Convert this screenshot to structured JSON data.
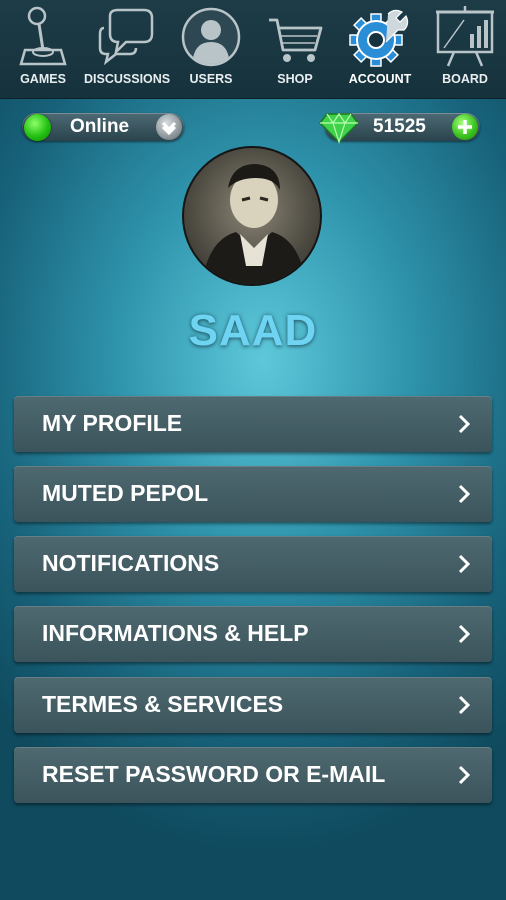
{
  "nav": {
    "items": [
      {
        "label": "GAMES",
        "icon": "joystick-icon"
      },
      {
        "label": "DISCUSSIONS",
        "icon": "chat-bubbles-icon"
      },
      {
        "label": "USERS",
        "icon": "user-icon"
      },
      {
        "label": "SHOP",
        "icon": "cart-icon"
      },
      {
        "label": "ACCOUNT",
        "icon": "gear-wrench-icon",
        "active": true
      },
      {
        "label": "BOARD",
        "icon": "presentation-board-icon"
      }
    ]
  },
  "status": {
    "label": "Online",
    "color": "#22c012"
  },
  "gems": {
    "count": "51525",
    "color": "#3cc420"
  },
  "profile": {
    "username": "SAAD",
    "username_color": "#6fd3f2"
  },
  "menu": [
    {
      "label": "MY PROFILE"
    },
    {
      "label": "MUTED PEPOL"
    },
    {
      "label": "NOTIFICATIONS"
    },
    {
      "label": "INFORMATIONS & HELP"
    },
    {
      "label": "TERMES & SERVICES"
    },
    {
      "label": "RESET PASSWORD OR E-MAIL"
    }
  ],
  "colors": {
    "background": "#2f95ad",
    "topbar": "#1d3c47",
    "accent_active": "#2a8ed6"
  }
}
